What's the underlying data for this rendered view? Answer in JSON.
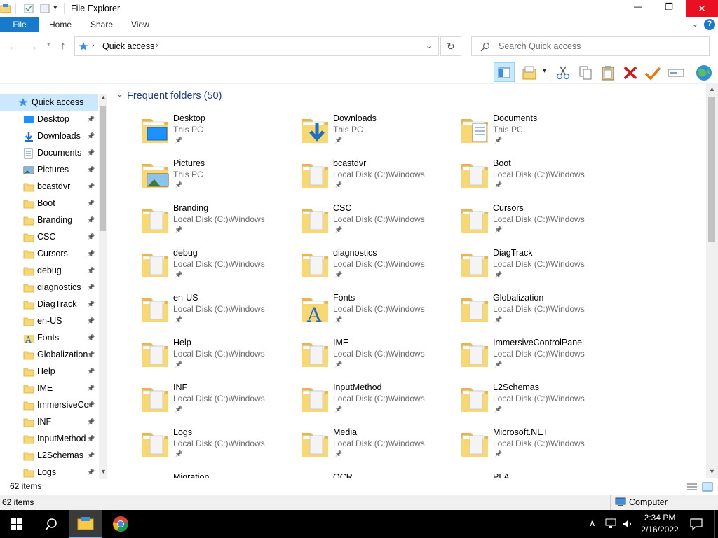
{
  "window": {
    "title": "File Explorer",
    "minimize_glyph": "—",
    "maximize_glyph": "❐",
    "close_glyph": "✕",
    "help_glyph": "?",
    "ribbon_toggle_glyph": "⌄"
  },
  "ribbon": {
    "file_label": "File",
    "tabs": [
      {
        "label": "Home"
      },
      {
        "label": "Share"
      },
      {
        "label": "View"
      }
    ]
  },
  "navigation": {
    "breadcrumb": [
      "Quick access"
    ],
    "search_placeholder": "Search Quick access"
  },
  "sidebar": {
    "quick_access_label": "Quick access",
    "items": [
      {
        "label": "Desktop",
        "icon": "desktop-icon"
      },
      {
        "label": "Downloads",
        "icon": "downloads-icon"
      },
      {
        "label": "Documents",
        "icon": "documents-icon"
      },
      {
        "label": "Pictures",
        "icon": "pictures-icon"
      },
      {
        "label": "bcastdvr",
        "icon": "folder-icon"
      },
      {
        "label": "Boot",
        "icon": "folder-icon"
      },
      {
        "label": "Branding",
        "icon": "folder-icon"
      },
      {
        "label": "CSC",
        "icon": "folder-icon"
      },
      {
        "label": "Cursors",
        "icon": "folder-icon"
      },
      {
        "label": "debug",
        "icon": "folder-icon"
      },
      {
        "label": "diagnostics",
        "icon": "folder-icon"
      },
      {
        "label": "DiagTrack",
        "icon": "folder-icon"
      },
      {
        "label": "en-US",
        "icon": "folder-icon"
      },
      {
        "label": "Fonts",
        "icon": "fonts-icon"
      },
      {
        "label": "Globalization",
        "icon": "folder-icon"
      },
      {
        "label": "Help",
        "icon": "folder-icon"
      },
      {
        "label": "IME",
        "icon": "folder-icon"
      },
      {
        "label": "ImmersiveCo",
        "icon": "folder-icon"
      },
      {
        "label": "INF",
        "icon": "folder-icon"
      },
      {
        "label": "InputMethod",
        "icon": "folder-icon"
      },
      {
        "label": "L2Schemas",
        "icon": "folder-icon"
      },
      {
        "label": "Logs",
        "icon": "folder-icon"
      }
    ]
  },
  "content": {
    "group_header": "Frequent folders (50)",
    "folders": [
      {
        "name": "Desktop",
        "path": "This PC",
        "icon": "desktop-folder-icon"
      },
      {
        "name": "Downloads",
        "path": "This PC",
        "icon": "downloads-folder-icon"
      },
      {
        "name": "Documents",
        "path": "This PC",
        "icon": "documents-folder-icon"
      },
      {
        "name": "Pictures",
        "path": "This PC",
        "icon": "pictures-folder-icon"
      },
      {
        "name": "bcastdvr",
        "path": "Local Disk (C:)\\Windows",
        "icon": "folder-icon"
      },
      {
        "name": "Boot",
        "path": "Local Disk (C:)\\Windows",
        "icon": "folder-icon"
      },
      {
        "name": "Branding",
        "path": "Local Disk (C:)\\Windows",
        "icon": "folder-icon"
      },
      {
        "name": "CSC",
        "path": "Local Disk (C:)\\Windows",
        "icon": "folder-icon"
      },
      {
        "name": "Cursors",
        "path": "Local Disk (C:)\\Windows",
        "icon": "folder-icon"
      },
      {
        "name": "debug",
        "path": "Local Disk (C:)\\Windows",
        "icon": "folder-icon"
      },
      {
        "name": "diagnostics",
        "path": "Local Disk (C:)\\Windows",
        "icon": "folder-icon"
      },
      {
        "name": "DiagTrack",
        "path": "Local Disk (C:)\\Windows",
        "icon": "folder-icon"
      },
      {
        "name": "en-US",
        "path": "Local Disk (C:)\\Windows",
        "icon": "folder-icon"
      },
      {
        "name": "Fonts",
        "path": "Local Disk (C:)\\Windows",
        "icon": "fonts-folder-icon"
      },
      {
        "name": "Globalization",
        "path": "Local Disk (C:)\\Windows",
        "icon": "folder-icon"
      },
      {
        "name": "Help",
        "path": "Local Disk (C:)\\Windows",
        "icon": "folder-icon"
      },
      {
        "name": "IME",
        "path": "Local Disk (C:)\\Windows",
        "icon": "folder-icon"
      },
      {
        "name": "ImmersiveControlPanel",
        "path": "Local Disk (C:)\\Windows",
        "icon": "folder-icon"
      },
      {
        "name": "INF",
        "path": "Local Disk (C:)\\Windows",
        "icon": "folder-icon"
      },
      {
        "name": "InputMethod",
        "path": "Local Disk (C:)\\Windows",
        "icon": "folder-icon"
      },
      {
        "name": "L2Schemas",
        "path": "Local Disk (C:)\\Windows",
        "icon": "folder-icon"
      },
      {
        "name": "Logs",
        "path": "Local Disk (C:)\\Windows",
        "icon": "folder-icon"
      },
      {
        "name": "Media",
        "path": "Local Disk (C:)\\Windows",
        "icon": "folder-icon"
      },
      {
        "name": "Microsoft.NET",
        "path": "Local Disk (C:)\\Windows",
        "icon": "folder-icon"
      },
      {
        "name": "Migration",
        "path": "",
        "icon": "folder-icon"
      },
      {
        "name": "OCR",
        "path": "",
        "icon": "folder-icon"
      },
      {
        "name": "PLA",
        "path": "",
        "icon": "folder-icon"
      }
    ]
  },
  "inner_status": {
    "item_count": "62 items"
  },
  "statusbar": {
    "item_count": "62 items",
    "location": "Computer"
  },
  "taskbar": {
    "time": "2:34 PM",
    "date": "2/16/2022"
  },
  "colors": {
    "accent": "#0063b1",
    "folder_yellow": "#f8d775",
    "folder_dark": "#e8b64a",
    "selection": "#cce8ff"
  }
}
